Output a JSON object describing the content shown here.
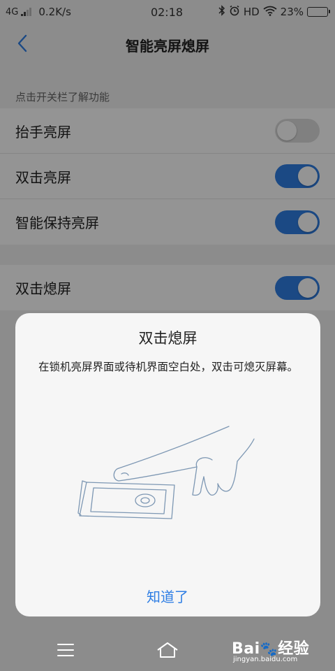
{
  "status_bar": {
    "network": "4G",
    "speed": "0.2K/s",
    "time": "02:18",
    "hd": "HD",
    "battery_percent": "23%",
    "battery_level": 0.23
  },
  "header": {
    "title": "智能亮屏熄屏"
  },
  "settings": {
    "section_hint": "点击开关栏了解功能",
    "items": [
      {
        "label": "抬手亮屏",
        "enabled": false
      },
      {
        "label": "双击亮屏",
        "enabled": true
      },
      {
        "label": "智能保持亮屏",
        "enabled": true
      },
      {
        "label": "双击熄屏",
        "enabled": true
      }
    ]
  },
  "dialog": {
    "title": "双击熄屏",
    "description": "在锁机亮屏界面或待机界面空白处，双击可熄灭屏幕。",
    "ok_label": "知道了"
  },
  "watermark": {
    "brand": "Bai",
    "brand_suffix": "经验",
    "url": "jingyan.baidu.com"
  },
  "colors": {
    "accent": "#2f7ee4",
    "toggle_off": "#dcdcdc",
    "background": "#f2f2f2"
  },
  "icons": {
    "back": "chevron-left-icon",
    "bluetooth": "bluetooth-icon",
    "alarm": "alarm-clock-icon",
    "wifi": "wifi-icon",
    "battery": "battery-icon",
    "menu": "menu-icon",
    "home": "home-icon"
  }
}
